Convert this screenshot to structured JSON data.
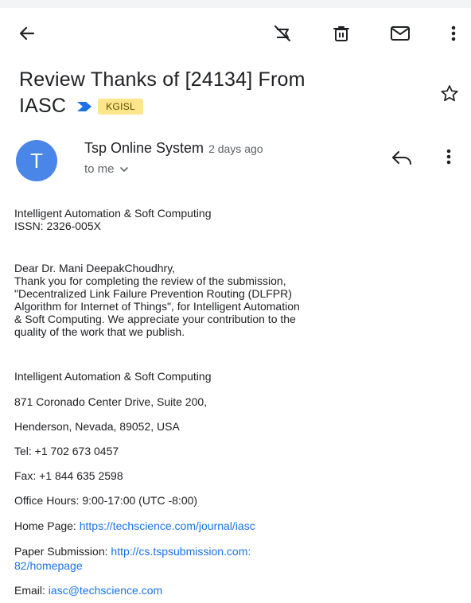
{
  "toolbar": {
    "icons": [
      "back-arrow-icon",
      "snooze-off-icon",
      "delete-icon",
      "mail-icon",
      "more-vert-icon"
    ]
  },
  "subject": {
    "line1": "Review Thanks of [24134] From",
    "line2": "IASC",
    "label": "KGISL"
  },
  "colors": {
    "accent": "#1a73e8",
    "avatar": "#4a86e8",
    "label_bg": "#fde68a"
  },
  "sender": {
    "initial": "T",
    "name": "Tsp Online System",
    "time": "2 days ago",
    "recipient": "to me"
  },
  "body": {
    "journal": "Intelligent Automation & Soft Computing",
    "issn": "ISSN: 2326-005X",
    "greeting": "Dear Dr. Mani DeepakChoudhry,",
    "lines": [
      "Thank you for completing the review of the submission,",
      "\"Decentralized Link Failure Prevention Routing (DLFPR)",
      "Algorithm for Internet of Things\", for Intelligent Automation",
      "& Soft Computing. We appreciate your contribution to the",
      "quality of the work that we publish."
    ]
  },
  "signature": {
    "org": "Intelligent Automation & Soft Computing",
    "address1": "871 Coronado Center Drive, Suite 200,",
    "address2": "Henderson, Nevada, 89052, USA",
    "tel": "Tel: +1 702 673 0457",
    "fax": "Fax: +1 844 635 2598",
    "hours": "Office Hours: 9:00-17:00 (UTC -8:00)",
    "home_label": "Home Page: ",
    "home_url": "https://techscience.com/journal/iasc",
    "submission_label": "Paper Submission: ",
    "submission_url_1": "http://cs.tspsubmission.com:",
    "submission_url_2": "82/homepage",
    "email_label": "Email: ",
    "email": "iasc@techscience.com"
  }
}
